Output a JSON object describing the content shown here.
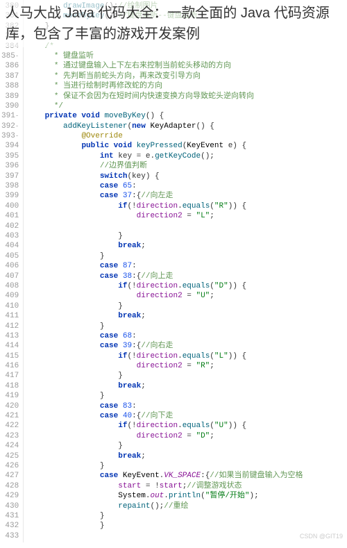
{
  "title": "人马大战 Java 代码大全：一款全面的 Java 代码资源库，包含了丰富的游戏开发案例",
  "watermark": "CSDN @GIT19",
  "lines": [
    {
      "n": "380",
      "c": "        drawImage();",
      "cm": "//绘制图片"
    },
    {
      "n": "381",
      "c": "        moveByKey();",
      "cm": "//键盘监听--键盘监听"
    },
    {
      "n": "382",
      "c": "    }"
    },
    {
      "n": "383",
      "c": ""
    },
    {
      "n": "384",
      "c": "    /*",
      "type": "c"
    },
    {
      "n": "385",
      "c": "      * 键盘监听",
      "type": "c",
      "fold": "-"
    },
    {
      "n": "386",
      "c": "      * 通过键盘输入上下左右来控制当前蛇头移动的方向",
      "type": "c"
    },
    {
      "n": "387",
      "c": "      * 先判断当前蛇头方向，再来改变引导方向",
      "type": "c"
    },
    {
      "n": "388",
      "c": "      * 当进行绘制时再修改蛇的方向",
      "type": "c"
    },
    {
      "n": "389",
      "c": "      * 保证不会因为在短时间内快速变换方向导致蛇头逆向转向",
      "type": "c"
    },
    {
      "n": "390",
      "c": "      */",
      "type": "c"
    },
    {
      "n": "391",
      "c": "    private void moveByKey() {",
      "type": "sig",
      "fold": "-"
    },
    {
      "n": "392",
      "c": "        addKeyListener(new KeyAdapter() {",
      "type": "sig2",
      "fold": "-"
    },
    {
      "n": "393",
      "c": "            @Override",
      "type": "anno",
      "fold": "-"
    },
    {
      "n": "394",
      "c": "            public void keyPressed(KeyEvent e) {",
      "type": "sig3"
    },
    {
      "n": "395",
      "c": "                int key = e.getKeyCode();",
      "type": "int"
    },
    {
      "n": "396",
      "c": "                ",
      "cm": "//边界值判断"
    },
    {
      "n": "397",
      "c": "                switch(key) {",
      "type": "sw"
    },
    {
      "n": "398",
      "c": "                case 65:",
      "type": "case"
    },
    {
      "n": "399",
      "c": "                case 37:{",
      "cm": "//向左走",
      "type": "case"
    },
    {
      "n": "400",
      "c": "                    if(!direction.equals(\"R\")) {",
      "type": "if"
    },
    {
      "n": "401",
      "c": "                        direction2 = \"L\";",
      "type": "assign"
    },
    {
      "n": "402",
      "c": ""
    },
    {
      "n": "403",
      "c": "                    }"
    },
    {
      "n": "404",
      "c": "                    break;",
      "type": "br"
    },
    {
      "n": "405",
      "c": "                }"
    },
    {
      "n": "406",
      "c": "                case 87:",
      "type": "case"
    },
    {
      "n": "407",
      "c": "                case 38:{",
      "cm": "//向上走",
      "type": "case"
    },
    {
      "n": "408",
      "c": "                    if(!direction.equals(\"D\")) {",
      "type": "if"
    },
    {
      "n": "409",
      "c": "                        direction2 = \"U\";",
      "type": "assign"
    },
    {
      "n": "410",
      "c": "                    }"
    },
    {
      "n": "411",
      "c": "                    break;",
      "type": "br"
    },
    {
      "n": "412",
      "c": "                }"
    },
    {
      "n": "413",
      "c": "                case 68:",
      "type": "case"
    },
    {
      "n": "414",
      "c": "                case 39:{",
      "cm": "//向右走",
      "type": "case"
    },
    {
      "n": "415",
      "c": "                    if(!direction.equals(\"L\")) {",
      "type": "if"
    },
    {
      "n": "416",
      "c": "                        direction2 = \"R\";",
      "type": "assign"
    },
    {
      "n": "417",
      "c": "                    }"
    },
    {
      "n": "418",
      "c": "                    break;",
      "type": "br"
    },
    {
      "n": "419",
      "c": "                }"
    },
    {
      "n": "420",
      "c": "                case 83:",
      "type": "case"
    },
    {
      "n": "421",
      "c": "                case 40:{",
      "cm": "//向下走",
      "type": "case"
    },
    {
      "n": "422",
      "c": "                    if(!direction.equals(\"U\")) {",
      "type": "if"
    },
    {
      "n": "423",
      "c": "                        direction2 = \"D\";",
      "type": "assign"
    },
    {
      "n": "424",
      "c": "                    }"
    },
    {
      "n": "425",
      "c": "                    break;",
      "type": "br"
    },
    {
      "n": "426",
      "c": "                }"
    },
    {
      "n": "427",
      "c": "                case KeyEvent.VK_SPACE:{",
      "cm": "//如果当前键盘输入为空格",
      "type": "casevk"
    },
    {
      "n": "428",
      "c": "                    start = !start;",
      "cm": "//调整游戏状态",
      "type": "st"
    },
    {
      "n": "429",
      "c": "                    System.out.println(\"暂停/开始\");",
      "type": "sysout"
    },
    {
      "n": "430",
      "c": "                    repaint();",
      "cm": "//重绘"
    },
    {
      "n": "431",
      "c": "                }"
    },
    {
      "n": "432",
      "c": "                }"
    },
    {
      "n": "433",
      "c": ""
    }
  ]
}
